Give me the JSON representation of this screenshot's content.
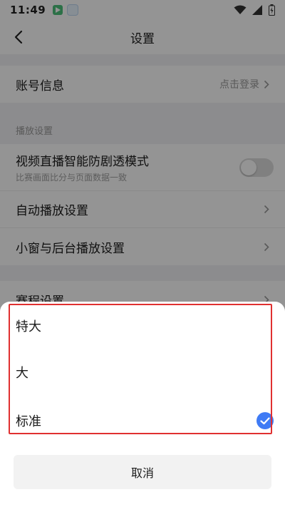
{
  "status_bar": {
    "time": "11:49"
  },
  "nav": {
    "title": "设置"
  },
  "account": {
    "label": "账号信息",
    "value": "点击登录"
  },
  "playback": {
    "group_title": "播放设置",
    "anti_spoiler": {
      "label": "视频直播智能防剧透模式",
      "subtitle": "比赛画面比分与页面数据一致",
      "enabled": false
    },
    "auto_play_label": "自动播放设置",
    "window_label": "小窗与后台播放设置"
  },
  "partial_row": {
    "label": "赛程设置"
  },
  "sheet": {
    "options": [
      {
        "label": "特大",
        "selected": false
      },
      {
        "label": "大",
        "selected": false
      },
      {
        "label": "标准",
        "selected": true
      }
    ],
    "cancel_label": "取消"
  },
  "colors": {
    "accent": "#3f7bf5",
    "highlight": "#e03030"
  }
}
